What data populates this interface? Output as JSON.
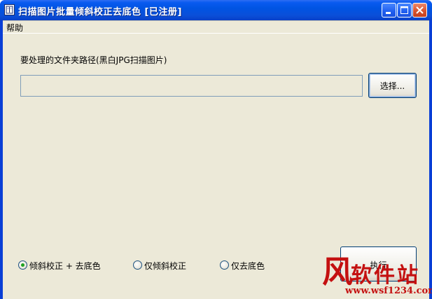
{
  "window": {
    "title": "扫描图片批量倾斜校正去底色 [已注册]"
  },
  "menu": {
    "items": [
      {
        "label": "帮助"
      }
    ]
  },
  "form": {
    "path_label": "要处理的文件夹路径(黑白JPG扫描图片)",
    "path_value": "",
    "choose_button": "选择...",
    "execute_button": "执行"
  },
  "options": [
    {
      "label": "倾斜校正 + 去底色",
      "checked": true
    },
    {
      "label": "仅倾斜校正",
      "checked": false
    },
    {
      "label": "仅去底色",
      "checked": false
    }
  ],
  "watermark": {
    "chars": [
      "风",
      "软",
      "件",
      "站"
    ],
    "url": "www.wsf1234.com"
  },
  "colors": {
    "titlebar": "#0054e3",
    "client_bg": "#ece9d8",
    "close_button": "#d9532f",
    "radio_checked": "#21a121",
    "watermark": "#c41010"
  },
  "icons": {
    "app": "book-icon",
    "minimize": "minimize-icon",
    "maximize": "maximize-icon",
    "close": "close-icon"
  }
}
